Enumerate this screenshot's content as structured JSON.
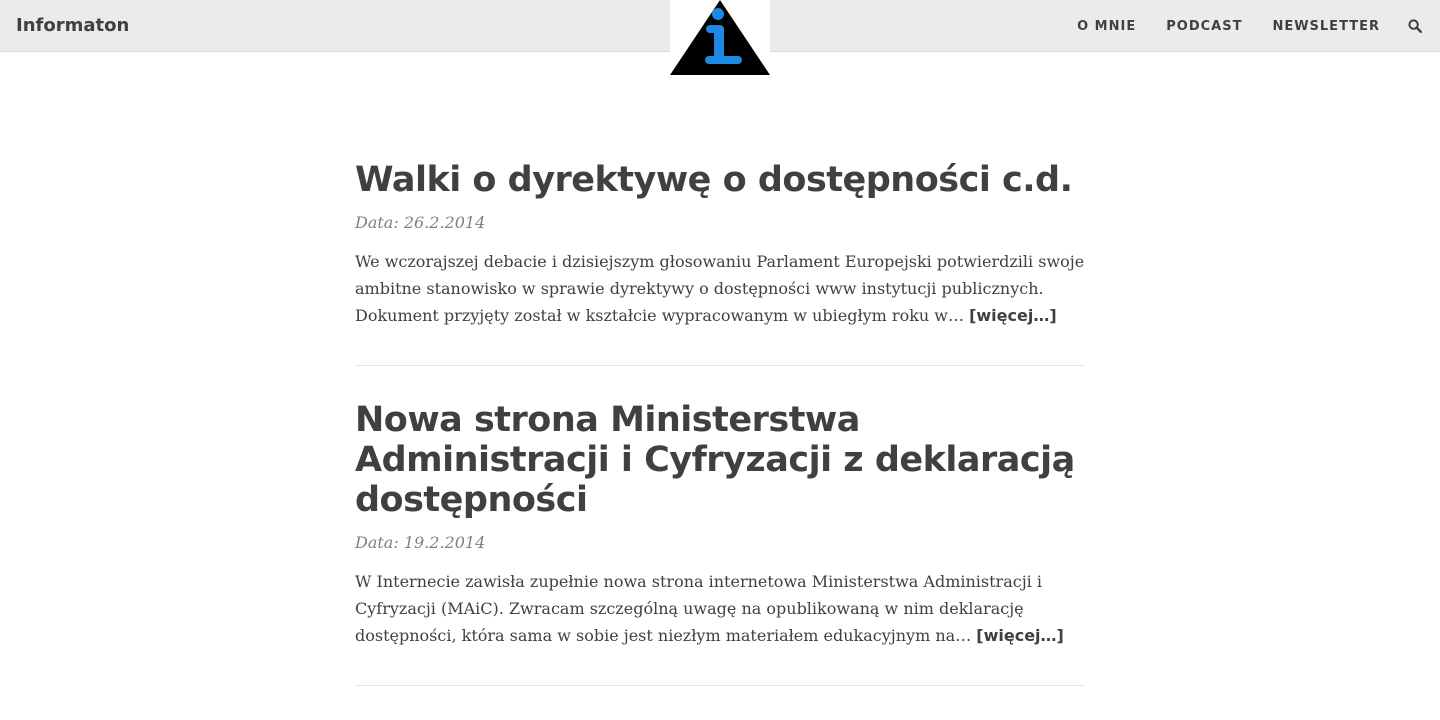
{
  "header": {
    "brand": "Informaton",
    "nav": [
      {
        "label": "O MNIE"
      },
      {
        "label": "PODCAST"
      },
      {
        "label": "NEWSLETTER"
      }
    ],
    "search_icon": "search-icon"
  },
  "logo": {
    "icon": "info-triangle-logo",
    "colors": {
      "triangle": "#000000",
      "glyph": "#1e88e5"
    }
  },
  "posts": [
    {
      "title": "Walki o dyrektywę o dostępności c.d.",
      "date": "Data: 26.2.2014",
      "excerpt": "We wczorajszej debacie i dzisiejszym głosowaniu Parlament Europejski potwierdzili swoje ambitne stanowisko w sprawie dyrektywy o dostępności www instytucji publicznych. Dokument przyjęty został w kształcie wypracowanym w ubiegłym roku w…",
      "more": "[więcej…]"
    },
    {
      "title": "Nowa strona Ministerstwa Administracji i Cyfryzacji z deklaracją dostępności",
      "date": "Data: 19.2.2014",
      "excerpt": "W Internecie zawisła zupełnie nowa strona internetowa Ministerstwa Administracji i Cyfryzacji (MAiC). Zwracam szczególną uwagę na opublikowaną w nim deklarację dostępności, która sama w sobie jest niezłym materiałem edukacyjnym na…",
      "more": "[więcej…]"
    }
  ],
  "colors": {
    "header_bg": "#ebebeb",
    "text": "#404040",
    "meta": "#808080"
  }
}
